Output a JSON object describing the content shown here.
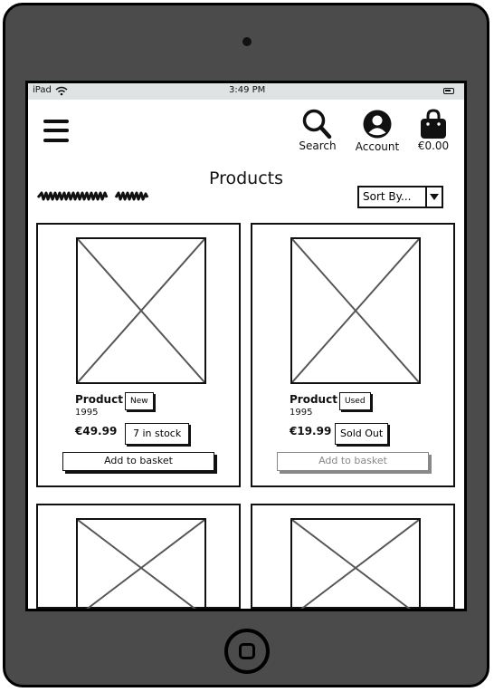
{
  "statusbar": {
    "device": "iPad",
    "time": "3:49 PM"
  },
  "header": {
    "search_label": "Search",
    "account_label": "Account",
    "basket_total": "€0.00"
  },
  "page": {
    "title": "Products"
  },
  "sort": {
    "selected": "Sort By..."
  },
  "products": [
    {
      "name": "Product",
      "condition": "New",
      "year": "1995",
      "price": "€49.99",
      "stock": "7 in stock",
      "button": "Add to basket",
      "button_enabled": true
    },
    {
      "name": "Product",
      "condition": "Used",
      "year": "1995",
      "price": "€19.99",
      "stock": "Sold Out",
      "button": "Add to basket",
      "button_enabled": false
    }
  ]
}
